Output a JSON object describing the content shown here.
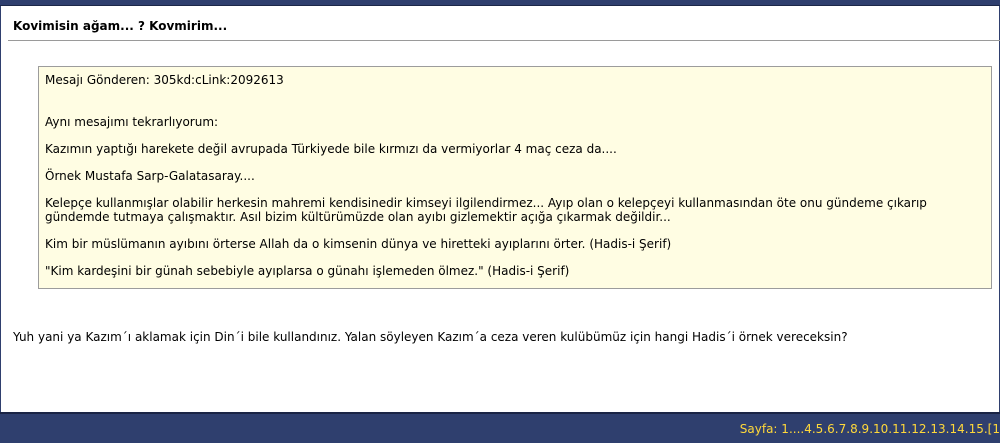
{
  "post": {
    "title": "Kovimisin ağam... ? Kovmirim...",
    "quote": {
      "sender": "Mesajı Gönderen: 305kd:cLink:2092613",
      "paragraphs": [
        "Aynı mesajımı tekrarlıyorum:",
        "Kazımın yaptığı harekete değil avrupada Türkiyede bile kırmızı da vermiyorlar 4 maç ceza da....",
        "Örnek Mustafa Sarp-Galatasaray....",
        "Kelepçe kullanmışlar olabilir herkesin mahremi kendisinedir kimseyi ilgilendirmez... Ayıp olan o kelepçeyi kullanmasından öte onu gündeme çıkarıp gündemde tutmaya çalışmaktır. Asıl bizim kültürümüzde olan ayıbı gizlemektir açığa çıkarmak değildir...",
        "Kim bir müslümanın ayıbını örterse Allah da o kimsenin dünya ve hiretteki ayıplarını örter. (Hadis-i Şerif)",
        "\"Kim kardeşini bir günah sebebiyle ayıplarsa o günahı işlemeden ölmez.\" (Hadis-i Şerif)"
      ]
    },
    "reply": "Yuh yani ya Kazım´ı aklamak için Din´i bile kullandınız. Yalan söyleyen Kazım´a ceza veren kulübümüz için hangi Hadis´i örnek vereceksin?"
  },
  "pager": {
    "label": "Sayfa:",
    "first": "1",
    "ellipsis": "....",
    "pages": [
      "4",
      "5",
      "6",
      "7",
      "8",
      "9",
      "10",
      "11",
      "12",
      "13",
      "14",
      "15"
    ],
    "current_prefix": "[",
    "current": "1"
  },
  "colors": {
    "bar": "#2f3f6e",
    "quote_bg": "#fffde3",
    "pager_text": "#ffd83a"
  }
}
